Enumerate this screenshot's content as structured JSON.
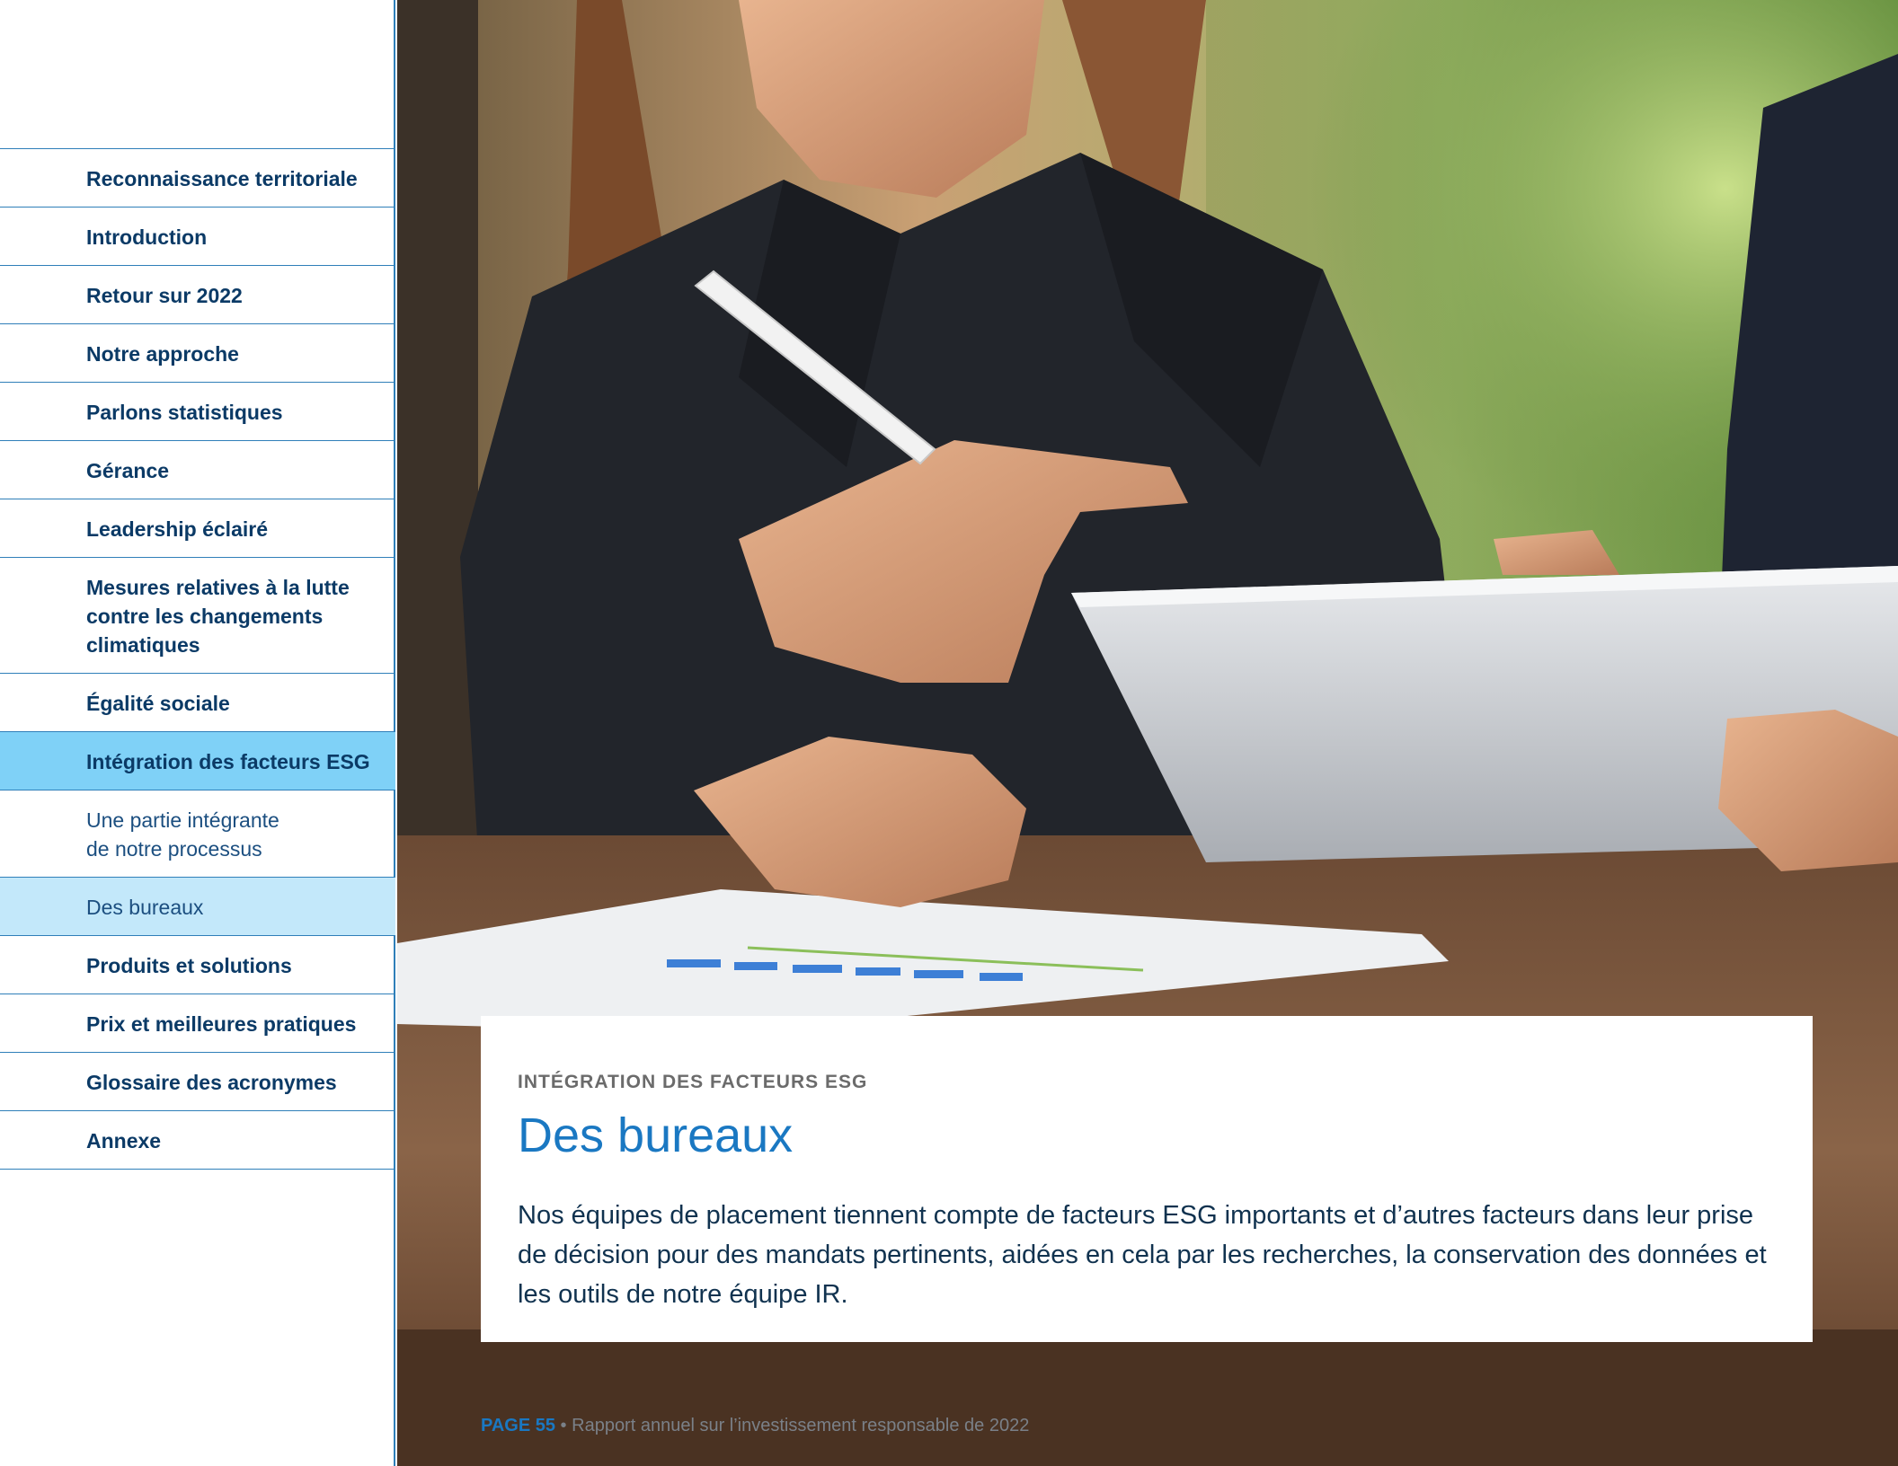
{
  "sidebar": {
    "items": [
      {
        "label": "Reconnaissance territoriale"
      },
      {
        "label": "Introduction"
      },
      {
        "label": "Retour sur 2022"
      },
      {
        "label": "Notre approche"
      },
      {
        "label": "Parlons statistiques"
      },
      {
        "label": "Gérance"
      },
      {
        "label": "Leadership éclairé"
      },
      {
        "label": "Mesures relatives à la lutte contre les changements climatiques"
      },
      {
        "label": "Égalité sociale"
      },
      {
        "label": "Intégration des facteurs ESG"
      },
      {
        "label": "Une partie intégrante de notre processus"
      },
      {
        "label": "Des bureaux"
      },
      {
        "label": "Produits et solutions"
      },
      {
        "label": "Prix et meilleures pratiques"
      },
      {
        "label": "Glossaire des acronymes"
      },
      {
        "label": "Annexe"
      }
    ]
  },
  "card": {
    "eyebrow": "INTÉGRATION DES FACTEURS ESG",
    "title": "Des bureaux",
    "body": "Nos équipes de placement tiennent compte de facteurs ESG importants et d’autres facteurs dans leur prise de décision pour des mandats pertinents, aidées en cela par les recherches, la conservation des données et les outils de notre équipe IR."
  },
  "footer": {
    "page": "PAGE 55",
    "separator": " • ",
    "report_title": "Rapport annuel sur l’investissement responsable de 2022"
  },
  "colors": {
    "accent_blue": "#1a78c2",
    "nav_text": "#0b3a66",
    "active_bg": "#7fd1f7",
    "subactive_bg": "#c3e8fa",
    "divider": "#2f7fb9"
  }
}
